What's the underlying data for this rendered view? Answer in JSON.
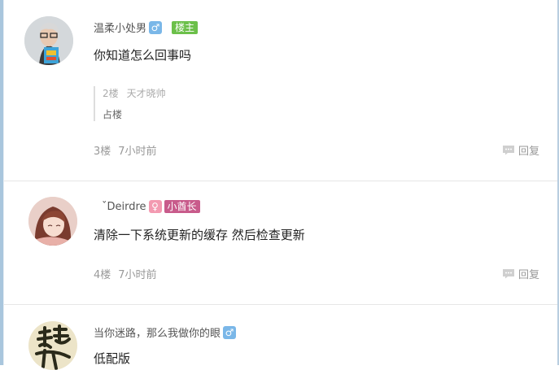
{
  "posts": [
    {
      "username": "温柔小处男",
      "gender_icon": "male-icon",
      "gender_glyph": "♂",
      "badge": "楼主",
      "content": "你知道怎么回事吗",
      "quote": {
        "floor": "2楼",
        "user": "天才晓帅",
        "text": "占楼"
      },
      "floor": "3楼",
      "time": "7小时前",
      "reply_label": "回复"
    },
    {
      "username": "ˇDeirdre",
      "gender_icon": "female-icon",
      "gender_glyph": "♀",
      "badge": "小酋长",
      "content": "清除一下系统更新的缓存 然后检查更新",
      "floor": "4楼",
      "time": "7小时前",
      "reply_label": "回复"
    },
    {
      "username": "当你迷路，那么我做你的眼",
      "gender_icon": "male-icon",
      "gender_glyph": "♂",
      "content": "低配版"
    }
  ],
  "colors": {
    "op_badge": "#6cc04a",
    "rank_badge": "#c85b8b",
    "male": "#7ab7e8",
    "female": "#f39ab1"
  }
}
